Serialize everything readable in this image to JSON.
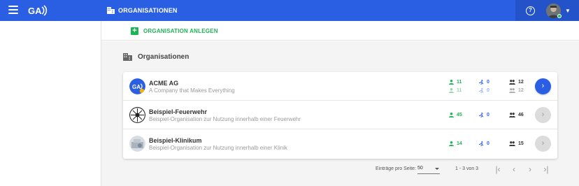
{
  "header": {
    "title": "ORGANISATIONEN",
    "menu_icon": "menu-icon",
    "logo_text": "GA",
    "help_icon": "help-circle-icon",
    "accent": "#2b5fe3"
  },
  "actions": {
    "create_label": "ORGANISATION ANLEGEN",
    "create_color": "#1bb556"
  },
  "section": {
    "title": "Organisationen"
  },
  "organisations": [
    {
      "name": "ACME AG",
      "description": "A Company that Makes Everything",
      "stats_primary": {
        "users": "11",
        "runners": "0",
        "groups": "12"
      },
      "stats_secondary": {
        "users": "11",
        "runners": "0",
        "groups": "12"
      }
    },
    {
      "name": "Beispiel-Feuerwehr",
      "description": "Beispiel-Organisation zur Nutzung innerhalb einer Feuerwehr",
      "stats_primary": {
        "users": "45",
        "runners": "0",
        "groups": "46"
      }
    },
    {
      "name": "Beispiel-Klinikum",
      "description": "Beispiel-Organisation zur Nutzung innerhalb einer Klinik",
      "stats_primary": {
        "users": "14",
        "runners": "0",
        "groups": "15"
      }
    }
  ],
  "pagination": {
    "per_page_label": "Einträge pro Seite:",
    "per_page_value": "50",
    "range": "1 - 3 von 3",
    "first_label": "|‹",
    "prev_label": "‹",
    "next_label": "›",
    "last_label": "›|"
  }
}
